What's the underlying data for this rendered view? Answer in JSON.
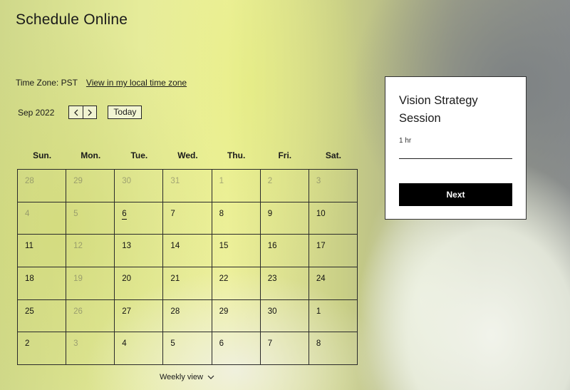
{
  "page": {
    "title": "Schedule Online"
  },
  "timezone": {
    "label": "Time Zone: PST",
    "local_link": "View in my local time zone"
  },
  "calendar": {
    "month_label": "Sep 2022",
    "today_label": "Today",
    "weekdays": [
      "Sun.",
      "Mon.",
      "Tue.",
      "Wed.",
      "Thu.",
      "Fri.",
      "Sat."
    ],
    "days": [
      {
        "d": "28",
        "dim": true
      },
      {
        "d": "29",
        "dim": true
      },
      {
        "d": "30",
        "dim": true
      },
      {
        "d": "31",
        "dim": true
      },
      {
        "d": "1",
        "dim": true
      },
      {
        "d": "2",
        "dim": true
      },
      {
        "d": "3",
        "dim": true
      },
      {
        "d": "4",
        "dim": true
      },
      {
        "d": "5",
        "dim": true
      },
      {
        "d": "6",
        "dim": false,
        "today": true
      },
      {
        "d": "7",
        "dim": false
      },
      {
        "d": "8",
        "dim": false
      },
      {
        "d": "9",
        "dim": false
      },
      {
        "d": "10",
        "dim": false
      },
      {
        "d": "11",
        "dim": false
      },
      {
        "d": "12",
        "dim": true
      },
      {
        "d": "13",
        "dim": false
      },
      {
        "d": "14",
        "dim": false
      },
      {
        "d": "15",
        "dim": false
      },
      {
        "d": "16",
        "dim": false
      },
      {
        "d": "17",
        "dim": false
      },
      {
        "d": "18",
        "dim": false
      },
      {
        "d": "19",
        "dim": true
      },
      {
        "d": "20",
        "dim": false
      },
      {
        "d": "21",
        "dim": false
      },
      {
        "d": "22",
        "dim": false
      },
      {
        "d": "23",
        "dim": false
      },
      {
        "d": "24",
        "dim": false
      },
      {
        "d": "25",
        "dim": false
      },
      {
        "d": "26",
        "dim": true
      },
      {
        "d": "27",
        "dim": false
      },
      {
        "d": "28",
        "dim": false
      },
      {
        "d": "29",
        "dim": false
      },
      {
        "d": "30",
        "dim": false
      },
      {
        "d": "1",
        "dim": false
      },
      {
        "d": "2",
        "dim": false
      },
      {
        "d": "3",
        "dim": true
      },
      {
        "d": "4",
        "dim": false
      },
      {
        "d": "5",
        "dim": false
      },
      {
        "d": "6",
        "dim": false
      },
      {
        "d": "7",
        "dim": false
      },
      {
        "d": "8",
        "dim": false
      }
    ],
    "view_toggle": "Weekly view",
    "icons": {
      "prev": "chevron-left-icon",
      "next": "chevron-right-icon",
      "toggle": "chevron-down-icon"
    }
  },
  "service": {
    "name": "Vision Strategy Session",
    "duration": "1 hr",
    "next_label": "Next"
  },
  "colors": {
    "button_bg": "#000000",
    "button_text": "#ffffff",
    "panel_bg": "#ffffff"
  }
}
